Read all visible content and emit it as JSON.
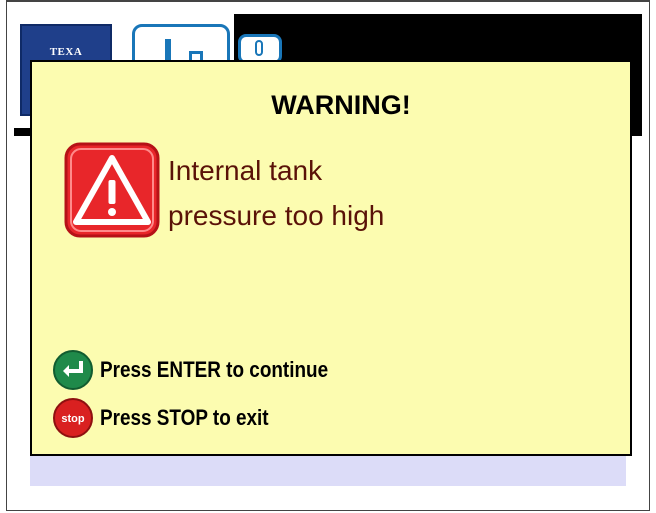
{
  "app": {
    "logo_text": "TEXA"
  },
  "dialog": {
    "title": "WARNING!",
    "message_line1": "Internal tank",
    "message_line2": "pressure too high",
    "actions": [
      {
        "icon": "enter-icon",
        "label": "Press ENTER to continue"
      },
      {
        "icon": "stop-icon",
        "label": "Press STOP to exit"
      }
    ]
  },
  "colors": {
    "dialog_bg": "#fcfcb0",
    "message_text": "#5a1208",
    "warning_red": "#e8262a",
    "enter_green": "#1f8a4a",
    "stop_red": "#d92020",
    "app_bg": "#dcdcf8"
  }
}
